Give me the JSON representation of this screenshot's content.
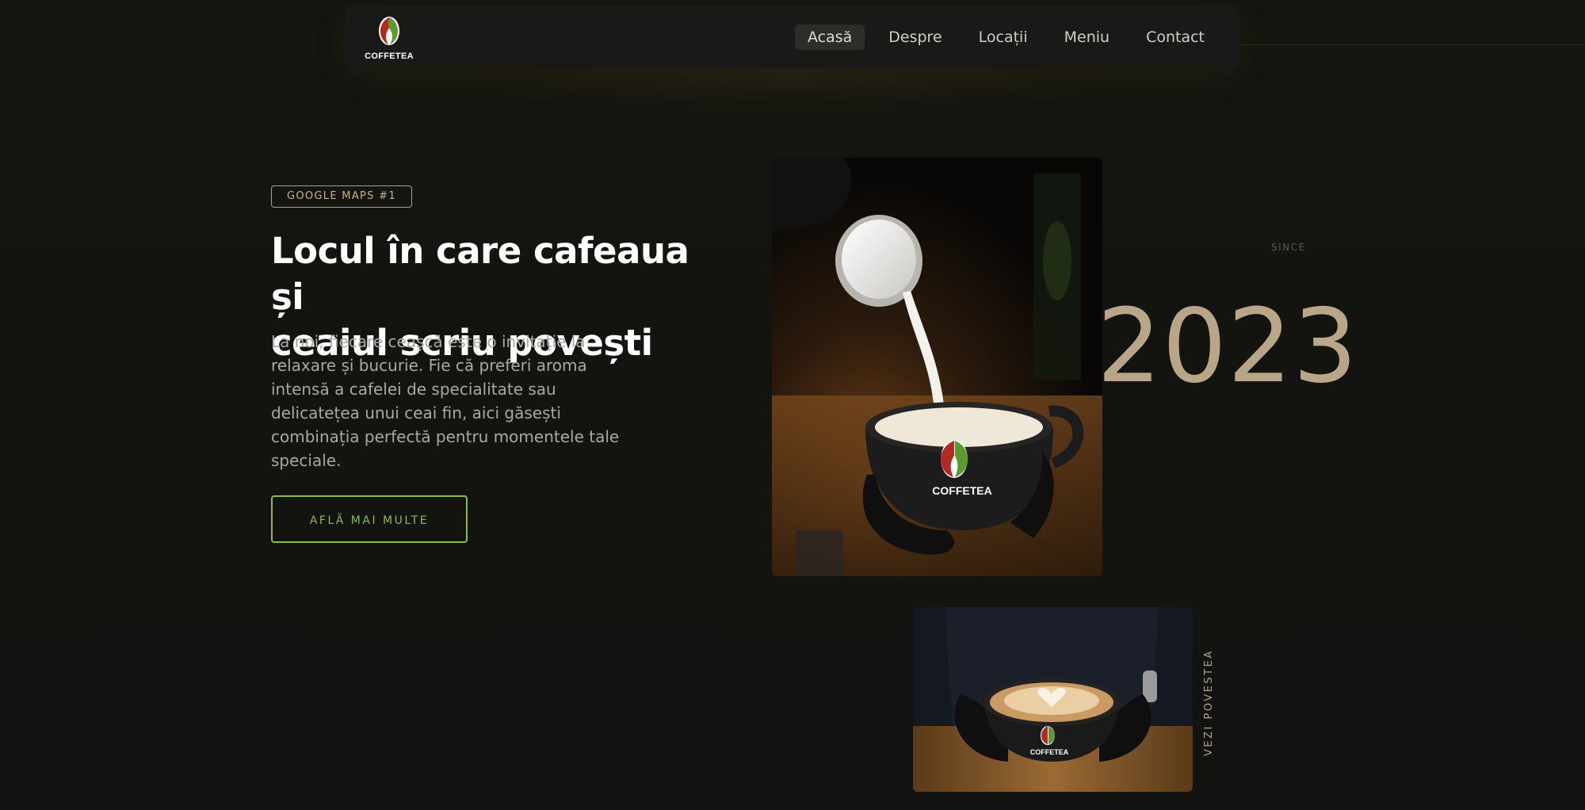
{
  "nav": {
    "logo_text": "COFFETEA",
    "items": [
      {
        "label": "Acasă",
        "active": true
      },
      {
        "label": "Despre",
        "active": false
      },
      {
        "label": "Locații",
        "active": false
      },
      {
        "label": "Meniu",
        "active": false
      },
      {
        "label": "Contact",
        "active": false
      }
    ]
  },
  "hero": {
    "badge": "GOOGLE MAPS #1",
    "headline_line1": "Locul în care cafeaua și",
    "headline_line2": "ceaiul scriu povești",
    "description": "La noi, fiecare ceașcă este o invitație la relaxare și bucurie. Fie că preferi aroma intensă a cafelei de specialitate sau delicatețea unui ceai fin, aici găsești combinația perfectă pentru momentele tale speciale.",
    "cta_label": "AFLĂ MAI MULTE"
  },
  "since": {
    "label": "SINCE",
    "year": "2023"
  },
  "story_link": "VEZI POVESTEA",
  "photos": {
    "main_cup_text": "COFFETEA",
    "small_cup_text": "COFFETEA"
  },
  "colors": {
    "background": "#131410",
    "accent_green": "#8fbb4a",
    "accent_gold": "#b9a587",
    "brand_red": "#b22a22",
    "brand_green": "#5c9a2e"
  }
}
